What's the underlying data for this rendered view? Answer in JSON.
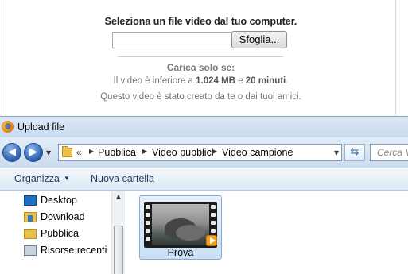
{
  "web_page": {
    "select_heading": "Seleziona un file video dal tuo computer.",
    "file_input_value": "",
    "browse_label": "Sfoglia...",
    "upload_only_heading": "Carica solo se:",
    "limit_prefix": "Il video è inferiore a ",
    "limit_size": "1.024 MB",
    "limit_and": " e ",
    "limit_duration": "20 minuti",
    "limit_suffix": ".",
    "own_video_text": "Questo video è stato creato da te o dai tuoi amici."
  },
  "dialog": {
    "title": "Upload file",
    "app_icon": "firefox-icon",
    "nav": {
      "back_icon": "back-arrow-icon",
      "forward_icon": "forward-arrow-icon"
    },
    "address": {
      "overflow": "«",
      "breadcrumbs": [
        "Pubblica",
        "Video pubblici",
        "Video campione"
      ]
    },
    "search": {
      "placeholder": "Cerca V"
    },
    "toolbar": {
      "organize_label": "Organizza",
      "new_folder_label": "Nuova cartella"
    },
    "nav_pane": {
      "items": [
        {
          "label": "Desktop",
          "icon": "desktop-icon"
        },
        {
          "label": "Download",
          "icon": "download-folder-icon"
        },
        {
          "label": "Pubblica",
          "icon": "folder-icon"
        },
        {
          "label": "Risorse recenti",
          "icon": "recent-places-icon"
        }
      ]
    },
    "files": [
      {
        "name": "Prova",
        "icon": "video-file-icon",
        "selected": true
      }
    ]
  },
  "colors": {
    "dialog_chrome": "#d6e4f4",
    "selection": "#c9dff6",
    "selection_border": "#84acdd"
  }
}
